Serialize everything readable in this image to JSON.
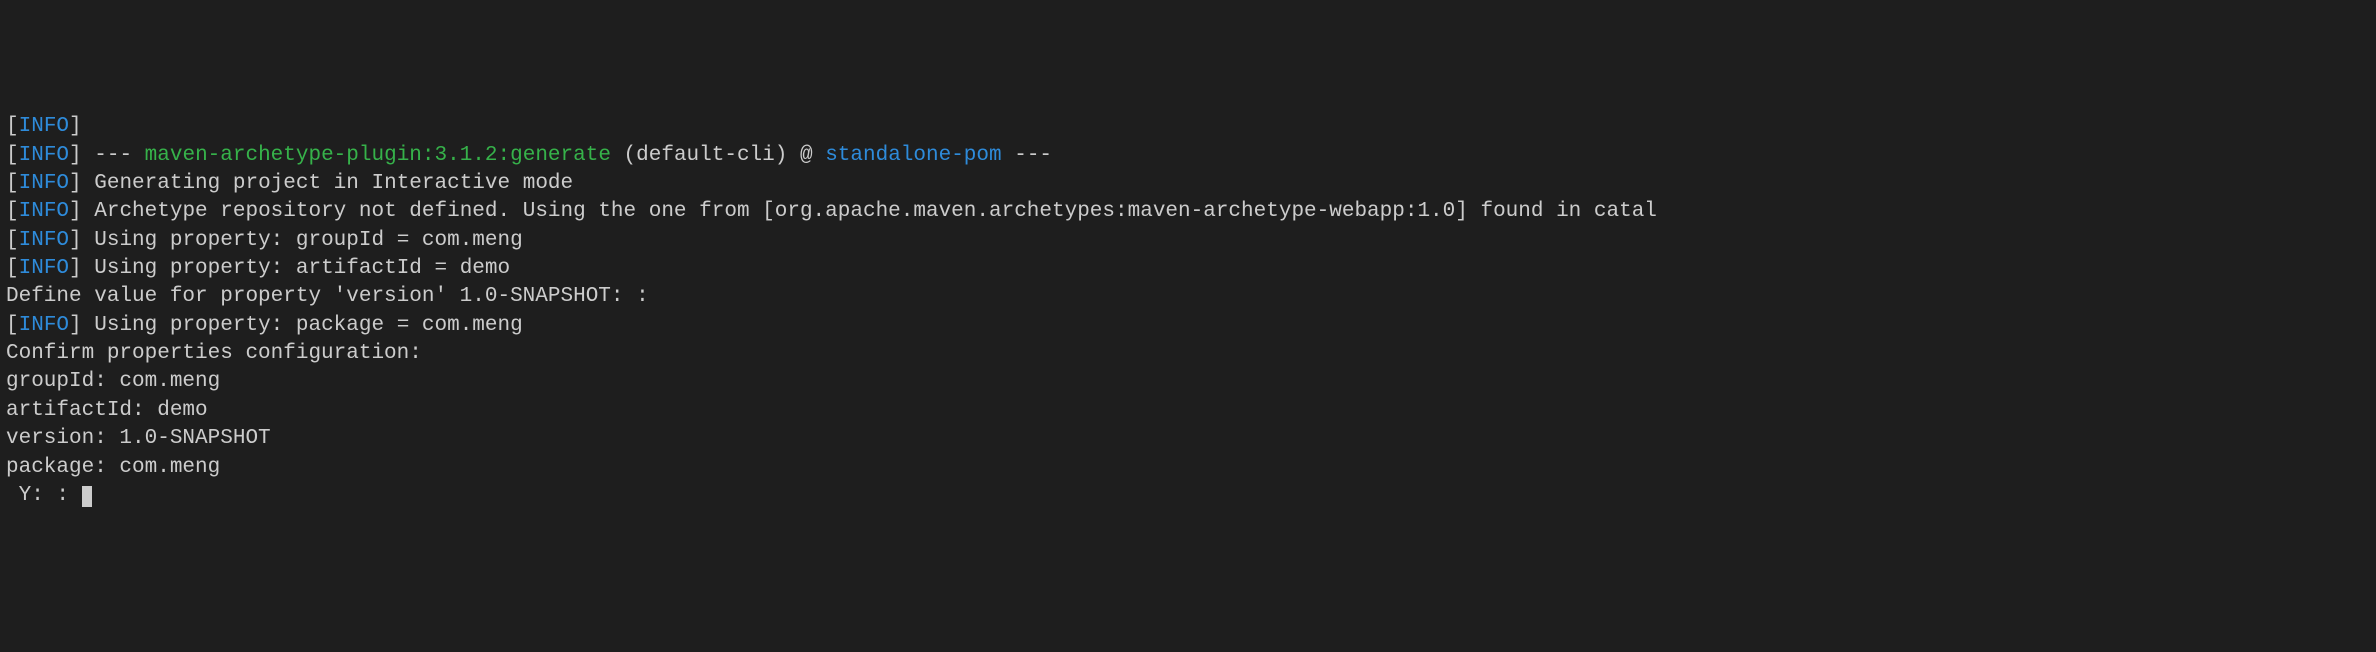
{
  "tag": {
    "open": "[",
    "close": "]",
    "info": "INFO"
  },
  "line0": {
    "plugin": "maven-archetype-plugin:3.1.2:generate",
    "mid": " (default-cli) @ ",
    "pom": "standalone-pom",
    "dashes_pre": " --- ",
    "dashes_post": " ---"
  },
  "line1": " Generating project in Interactive mode",
  "line2": " Archetype repository not defined. Using the one from [org.apache.maven.archetypes:maven-archetype-webapp:1.0] found in catal",
  "line3": " Using property: groupId = com.meng",
  "line4": " Using property: artifactId = demo",
  "line5": "Define value for property 'version' 1.0-SNAPSHOT: :",
  "line6": " Using property: package = com.meng",
  "line7": "Confirm properties configuration:",
  "line8": "groupId: com.meng",
  "line9": "artifactId: demo",
  "line10": "version: 1.0-SNAPSHOT",
  "line11": "package: com.meng",
  "line12": " Y: : "
}
